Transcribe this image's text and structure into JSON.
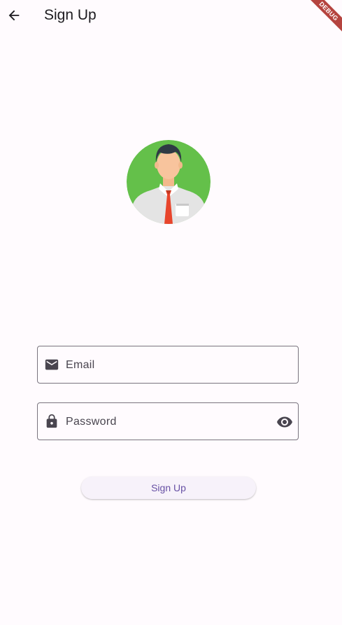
{
  "appbar": {
    "title": "Sign Up",
    "back_icon": "arrow-left-icon"
  },
  "debug_banner": {
    "label": "DEBUG",
    "color": "#b5443f"
  },
  "avatar": {
    "icon": "user-avatar-illustration",
    "background_color": "#64c04a"
  },
  "form": {
    "email": {
      "icon": "mail-icon",
      "label": "Email"
    },
    "password": {
      "icon": "lock-icon",
      "label": "Password",
      "toggle_icon": "eye-icon"
    },
    "submit_label": "Sign Up"
  },
  "colors": {
    "background": "#fffbfe",
    "accent": "#6750a4",
    "outline": "#79747e"
  }
}
